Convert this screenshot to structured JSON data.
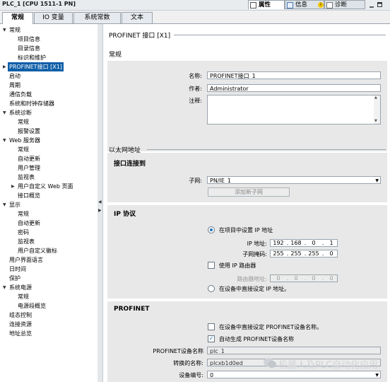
{
  "window": {
    "title": "PLC_1 [CPU 1511-1 PN]"
  },
  "inspector_tabs": [
    {
      "label": "属性",
      "icon": "properties-icon"
    },
    {
      "label": "信息",
      "icon": "info-icon"
    },
    {
      "label": "诊断",
      "icon": "diagnostics-icon"
    }
  ],
  "tabs": [
    "常规",
    "IO 变量",
    "系统常数",
    "文本"
  ],
  "tree": {
    "items": [
      {
        "label": "常规",
        "level": 0,
        "expand": "down"
      },
      {
        "label": "项目信息",
        "level": 2
      },
      {
        "label": "目录信息",
        "level": 2
      },
      {
        "label": "标识和维护",
        "level": 2
      },
      {
        "label": "PROFINET接口 [X1]",
        "level": 0,
        "expand": "right",
        "selected": true
      },
      {
        "label": "启动",
        "level": 0
      },
      {
        "label": "周期",
        "level": 0
      },
      {
        "label": "通信负载",
        "level": 0
      },
      {
        "label": "系统和时钟存储器",
        "level": 0
      },
      {
        "label": "系统诊断",
        "level": 0,
        "expand": "down"
      },
      {
        "label": "常规",
        "level": 2
      },
      {
        "label": "报警设置",
        "level": 2
      },
      {
        "label": "Web 服务器",
        "level": 0,
        "expand": "down"
      },
      {
        "label": "常规",
        "level": 2
      },
      {
        "label": "自动更新",
        "level": 2
      },
      {
        "label": "用户管理",
        "level": 2
      },
      {
        "label": "监视表",
        "level": 2
      },
      {
        "label": "用户自定义 Web 页面",
        "level": 2,
        "expand": "right"
      },
      {
        "label": "接口概览",
        "level": 2
      },
      {
        "label": "显示",
        "level": 0,
        "expand": "down"
      },
      {
        "label": "常规",
        "level": 2
      },
      {
        "label": "自动更新",
        "level": 2
      },
      {
        "label": "密码",
        "level": 2
      },
      {
        "label": "监视表",
        "level": 2
      },
      {
        "label": "用户自定义徽标",
        "level": 2
      },
      {
        "label": "用户界面语言",
        "level": 0
      },
      {
        "label": "日时间",
        "level": 0
      },
      {
        "label": "保护",
        "level": 0
      },
      {
        "label": "系统电源",
        "level": 0,
        "expand": "down"
      },
      {
        "label": "常规",
        "level": 2
      },
      {
        "label": "电源段概览",
        "level": 2
      },
      {
        "label": "组态控制",
        "level": 0
      },
      {
        "label": "连接资源",
        "level": 0
      },
      {
        "label": "地址总览",
        "level": 0
      }
    ]
  },
  "main": {
    "page_title": "PROFINET 接口 [X1]",
    "general": {
      "section_title": "常规",
      "name_label": "名称:",
      "name_value": "PROFINET接口_1",
      "author_label": "作者:",
      "author_value": "Administrator",
      "comment_label": "注释:",
      "comment_value": ""
    },
    "ethernet": {
      "section_title": "以太网地址",
      "connection_title": "接口连接到",
      "subnet_label": "子网:",
      "subnet_value": "PN/IE_1",
      "add_subnet_label": "添加新子网"
    },
    "ip": {
      "title": "IP 协议",
      "radio_project_label": "在项目中设置 IP 地址",
      "ip_label": "IP 地址:",
      "ip_octets": [
        "192",
        "168",
        "0",
        "1"
      ],
      "mask_label": "子网掩码:",
      "mask_octets": [
        "255",
        "255",
        "255",
        "0"
      ],
      "use_router_label": "使用 IP 路由器",
      "router_label": "路由器地址:",
      "router_octets": [
        "0",
        "0",
        "0",
        "0"
      ],
      "radio_device_label": "在设备中直接设定 IP 地址。"
    },
    "profinet": {
      "title": "PROFINET",
      "set_name_in_device_label": "在设备中直接设定 PROFINET设备名称。",
      "auto_generate_label": "自动生成 PROFINET设备名称",
      "device_name_label": "PROFINET设备名称",
      "device_name_value": "plc_1",
      "converted_name_label": "转换的名称:",
      "converted_name_value": "plcxb1d0ed",
      "device_number_label": "设备编号:",
      "device_number_value": "0"
    }
  },
  "watermark": {
    "text": "机器人及PLC自动化应用"
  },
  "colors": {
    "selection": "#0f5fa8",
    "accent": "#1e73be"
  }
}
